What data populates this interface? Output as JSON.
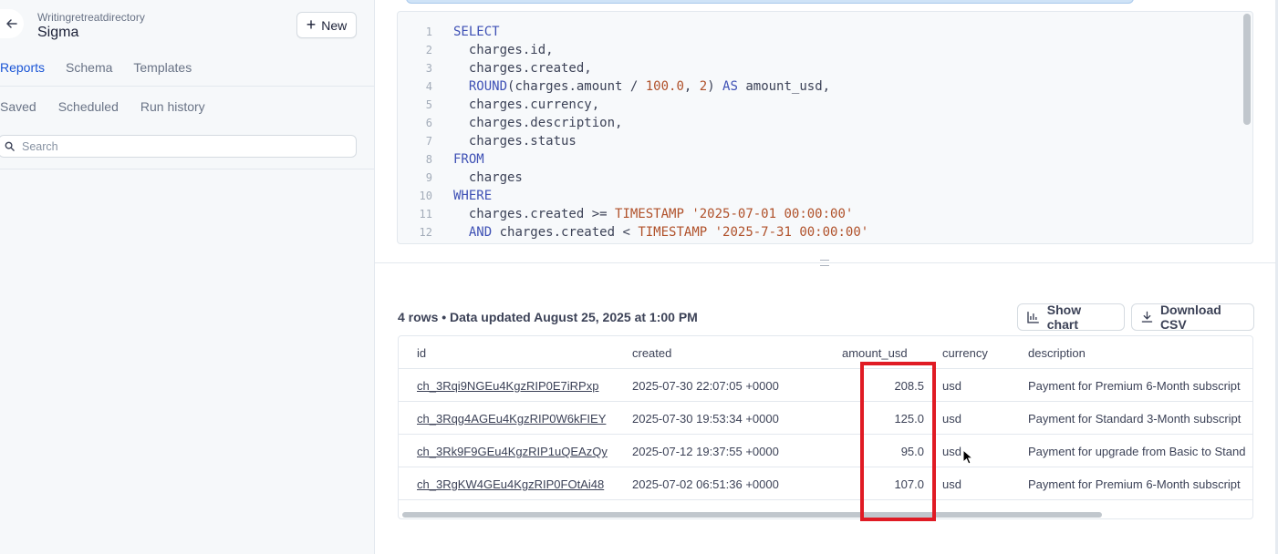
{
  "sidebar": {
    "account": "Writingretreatdirectory",
    "app_title": "Sigma",
    "new_button": "New",
    "tabs": [
      "Reports",
      "Schema",
      "Templates"
    ],
    "subtabs": [
      "Saved",
      "Scheduled",
      "Run history"
    ],
    "search_placeholder": "Search"
  },
  "editor": {
    "lines": [
      {
        "n": "1"
      },
      {
        "n": "2"
      },
      {
        "n": "3"
      },
      {
        "n": "4"
      },
      {
        "n": "5"
      },
      {
        "n": "6"
      },
      {
        "n": "7"
      },
      {
        "n": "8"
      },
      {
        "n": "9"
      },
      {
        "n": "10"
      },
      {
        "n": "11"
      },
      {
        "n": "12"
      }
    ],
    "code": {
      "l1": "SELECT",
      "l2": "  charges.id,",
      "l3": "  charges.created,",
      "l4_fn": "ROUND",
      "l4_a": "(charges.amount / ",
      "l4_num1": "100.0",
      "l4_b": ", ",
      "l4_num2": "2",
      "l4_c": ") ",
      "l4_as": "AS",
      "l4_d": " amount_usd,",
      "l5": "  charges.currency,",
      "l6": "  charges.description,",
      "l7": "  charges.status",
      "l8": "FROM",
      "l9": "  charges",
      "l10": "WHERE",
      "l11_a": "  charges.created >= ",
      "l11_ts": "TIMESTAMP",
      "l11_str": "'2025-07-01 00:00:00'",
      "l12_and": "AND",
      "l12_a": " charges.created < ",
      "l12_ts": "TIMESTAMP",
      "l12_str": "'2025-7-31 00:00:00'"
    }
  },
  "results": {
    "meta": "4 rows • Data updated August 25, 2025 at 1:00 PM",
    "show_chart": "Show chart",
    "download_csv": "Download CSV",
    "columns": [
      "id",
      "created",
      "amount_usd",
      "currency",
      "description"
    ],
    "rows": [
      {
        "id": "ch_3Rqi9NGEu4KgzRIP0E7iRPxp",
        "created": "2025-07-30 22:07:05 +0000",
        "amount_usd": "208.5",
        "currency": "usd",
        "description": "Payment for Premium 6-Month subscript"
      },
      {
        "id": "ch_3Rqg4AGEu4KgzRIP0W6kFIEY",
        "created": "2025-07-30 19:53:34 +0000",
        "amount_usd": "125.0",
        "currency": "usd",
        "description": "Payment for Standard 3-Month subscript"
      },
      {
        "id": "ch_3Rk9F9GEu4KgzRIP1uQEAzQy",
        "created": "2025-07-12 19:37:55 +0000",
        "amount_usd": "95.0",
        "currency": "usd",
        "description": "Payment for upgrade from Basic to Stand"
      },
      {
        "id": "ch_3RgKW4GEu4KgzRIP0FOtAi48",
        "created": "2025-07-02 06:51:36 +0000",
        "amount_usd": "107.0",
        "currency": "usd",
        "description": "Payment for Premium 6-Month subscript"
      }
    ]
  },
  "colors": {
    "accent": "#1a55d6",
    "highlight": "#e01b24"
  }
}
